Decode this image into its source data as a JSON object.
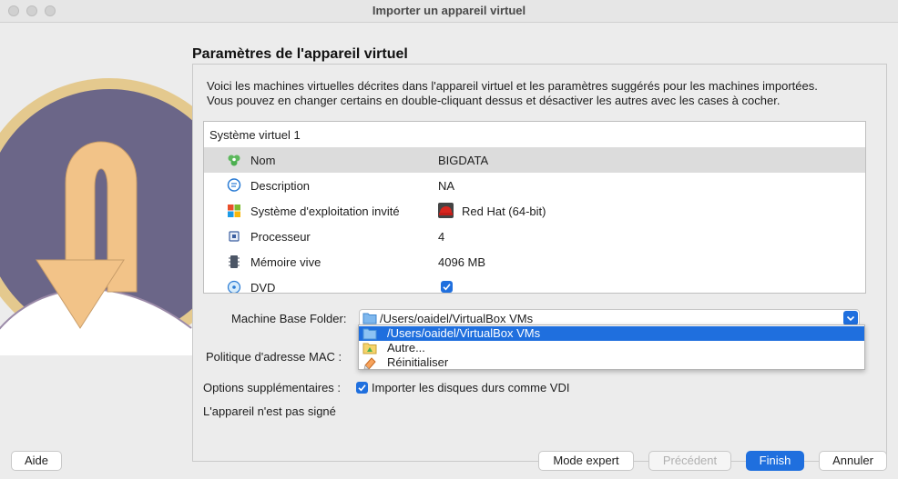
{
  "window": {
    "title": "Importer un appareil virtuel"
  },
  "page": {
    "title": "Paramètres de l'appareil virtuel",
    "description_line1": "Voici les machines virtuelles décrites dans l'appareil virtuel et les paramètres suggérés pour les machines importées.",
    "description_line2": "Vous pouvez en changer certains en double-cliquant dessus et désactiver les autres avec les cases à cocher."
  },
  "tree": {
    "header": "Système virtuel 1",
    "rows": [
      {
        "label": "Nom",
        "value": "BIGDATA",
        "icon": "name-icon"
      },
      {
        "label": "Description",
        "value": "NA",
        "icon": "description-icon"
      },
      {
        "label": "Système d'exploitation invité",
        "value": "Red Hat (64-bit)",
        "icon": "os-icon"
      },
      {
        "label": "Processeur",
        "value": "4",
        "icon": "cpu-icon"
      },
      {
        "label": "Mémoire vive",
        "value": "4096 MB",
        "icon": "memory-icon"
      },
      {
        "label": "DVD",
        "value": "",
        "checked": true,
        "icon": "dvd-icon"
      }
    ]
  },
  "form": {
    "machine_folder_label": "Machine Base Folder:",
    "machine_folder_value": "/Users/oaidel/VirtualBox VMs",
    "folder_options": [
      {
        "label": "/Users/oaidel/VirtualBox VMs",
        "icon": "folder-icon",
        "highlighted": true
      },
      {
        "label": "Autre...",
        "icon": "other-folder-icon"
      },
      {
        "label": "Réinitialiser",
        "icon": "reset-icon"
      }
    ],
    "mac_policy_label": "Politique d'adresse MAC :",
    "extra_options_label": "Options supplémentaires :",
    "import_vdi_label": "Importer les disques durs comme VDI",
    "import_vdi_checked": true,
    "not_signed": "L'appareil n'est pas signé"
  },
  "buttons": {
    "help": "Aide",
    "expert": "Mode expert",
    "previous": "Précédent",
    "finish": "Finish",
    "cancel": "Annuler"
  },
  "colors": {
    "accent": "#1f6fde",
    "window_bg": "#ececec",
    "selected_row": "#dcdcdc"
  }
}
